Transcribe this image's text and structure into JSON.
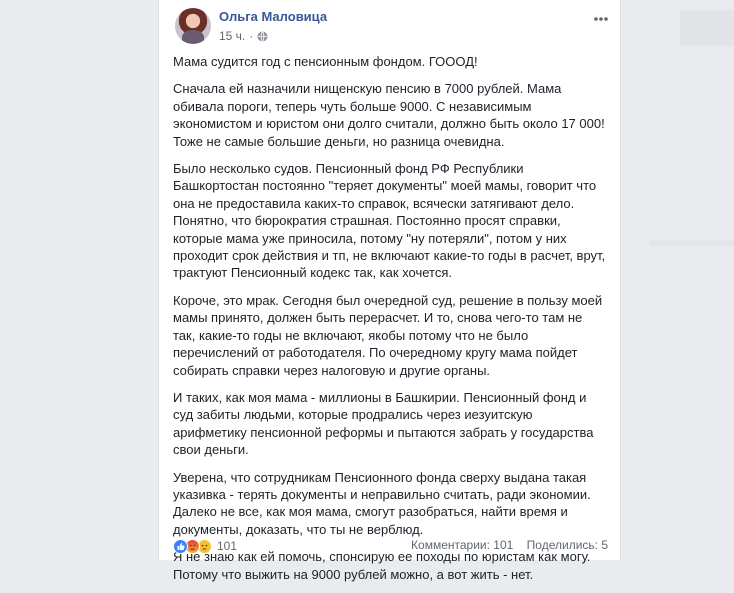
{
  "post": {
    "author": "Ольга Маловица",
    "time": "15 ч.",
    "dot": "·",
    "paragraphs": [
      "Мама судится год с пенсионным фондом. ГОООД!",
      "Сначала ей назначили нищенскую пенсию в 7000 рублей. Мама обивала пороги, теперь чуть больше 9000. С независимым экономистом и юристом они долго считали, должно быть около 17 000! Тоже не самые большие деньги, но разница очевидна.",
      "Было несколько судов. Пенсионный фонд РФ Республики Башкортостан постоянно \"теряет документы\" моей мамы, говорит что она не предоставила каких-то справок, всячески затягивают дело. Понятно, что бюрократия страшная. Постоянно просят справки, которые мама уже приносила, потому \"ну потеряли\", потом у них проходит срок действия и тп, не включают какие-то годы в расчет, врут, трактуют Пенсионный кодекс так, как хочется.",
      "Короче, это мрак. Сегодня был очередной суд, решение в пользу моей мамы принято, должен быть перерасчет. И то, снова чего-то там не так, какие-то годы не включают, якобы потому что не было перечислений от работодателя. По очередному кругу мама пойдет собирать справки через налоговую и другие органы.",
      "И таких, как моя мама - миллионы в Башкирии. Пенсионный фонд и суд забиты людьми, которые продрались через иезуитскую арифметику пенсионной реформы и пытаются забрать у государства свои деньги.",
      "Уверена, что сотрудникам Пенсионного фонда сверху выдана такая указивка - терять документы и неправильно считать, ради экономии. Далеко не все, как моя мама, смогут разобраться, найти время и документы, доказать, что ты не верблюд.",
      "Я не знаю как ей помочь, спонсирую ее походы по юристам как могу. Потому что выжить на 9000 рублей можно, а вот жить - нет."
    ]
  },
  "footer": {
    "reactions_count": "101",
    "comments": "Комментарии: 101",
    "shares": "Поделились: 5"
  },
  "icons": {
    "avatar": "user-avatar",
    "privacy": "globe-icon",
    "more": "more-options-icon",
    "reactions": [
      "like-icon",
      "angry-icon",
      "sad-icon"
    ]
  },
  "colors": {
    "author_link": "#385898",
    "text": "#1d2129",
    "meta": "#616770",
    "page_bg": "#e9ebee"
  }
}
